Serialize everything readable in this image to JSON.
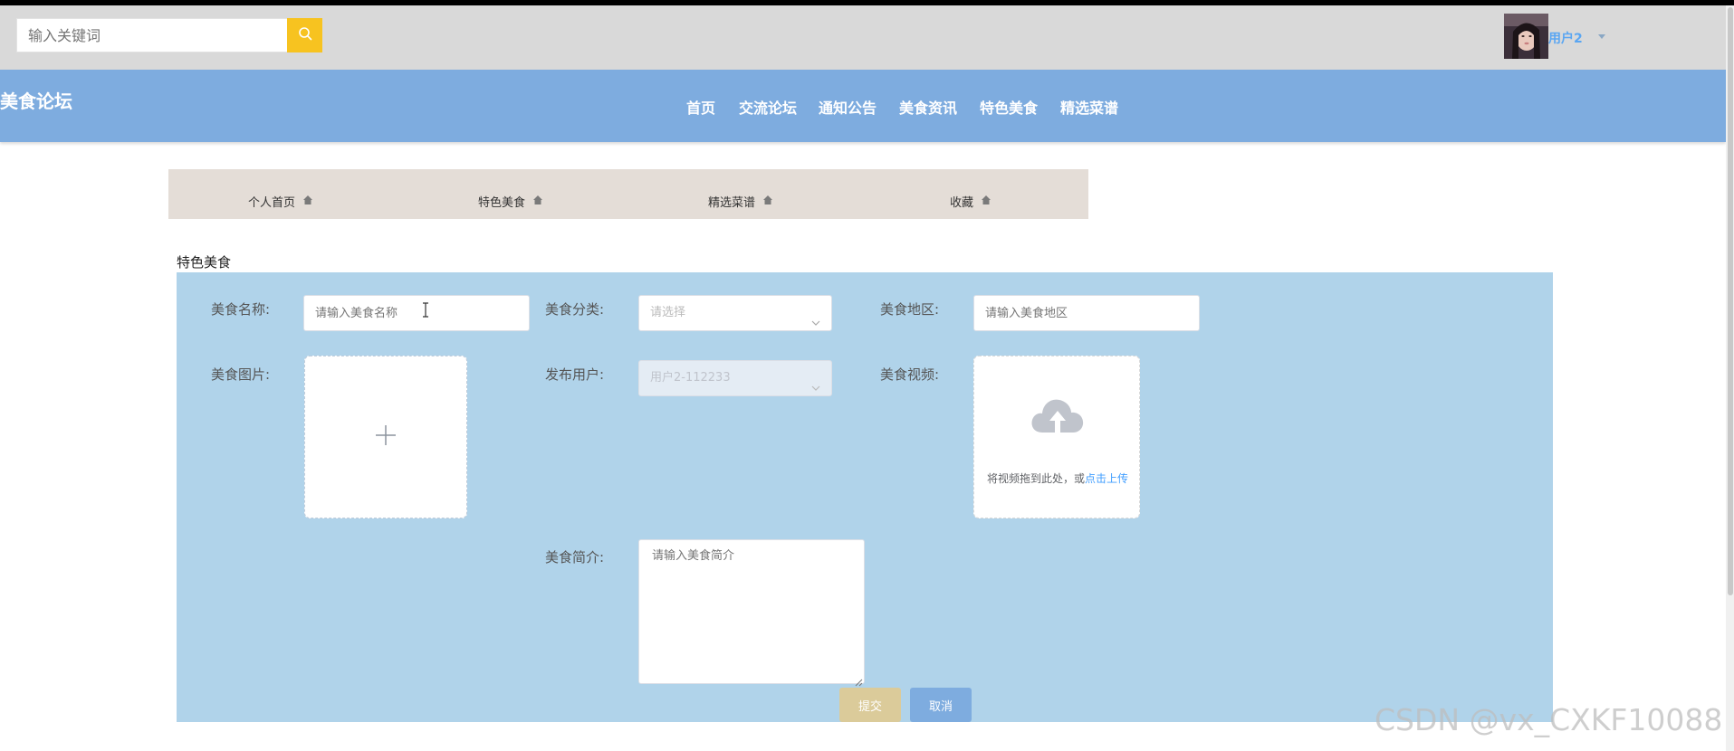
{
  "header": {
    "search_placeholder": "输入关键词",
    "user_name": "用户2"
  },
  "nav": {
    "brand": "美食论坛",
    "items": [
      "首页",
      "交流论坛",
      "通知公告",
      "美食资讯",
      "特色美食",
      "精选菜谱"
    ]
  },
  "subnav": {
    "items": [
      "个人首页",
      "特色美食",
      "精选菜谱",
      "收藏"
    ]
  },
  "section_title": "特色美食",
  "form": {
    "name_label": "美食名称:",
    "name_placeholder": "请输入美食名称",
    "category_label": "美食分类:",
    "category_placeholder": "请选择",
    "region_label": "美食地区:",
    "region_placeholder": "请输入美食地区",
    "image_label": "美食图片:",
    "publisher_label": "发布用户:",
    "publisher_value": "用户2-112233",
    "video_label": "美食视频:",
    "video_upload_text": "将视频拖到此处，或",
    "video_upload_link": "点击上传",
    "intro_label": "美食简介:",
    "intro_placeholder": "请输入美食简介",
    "submit_label": "提交",
    "cancel_label": "取消"
  },
  "watermark": "CSDN @vx_CXKF10088",
  "colors": {
    "navbar": "#7eacdf",
    "search_button": "#f7c320",
    "form_panel": "#b0d3ea",
    "submit": "#dbcb9a",
    "cancel": "#7eacdf",
    "link": "#409eff"
  }
}
